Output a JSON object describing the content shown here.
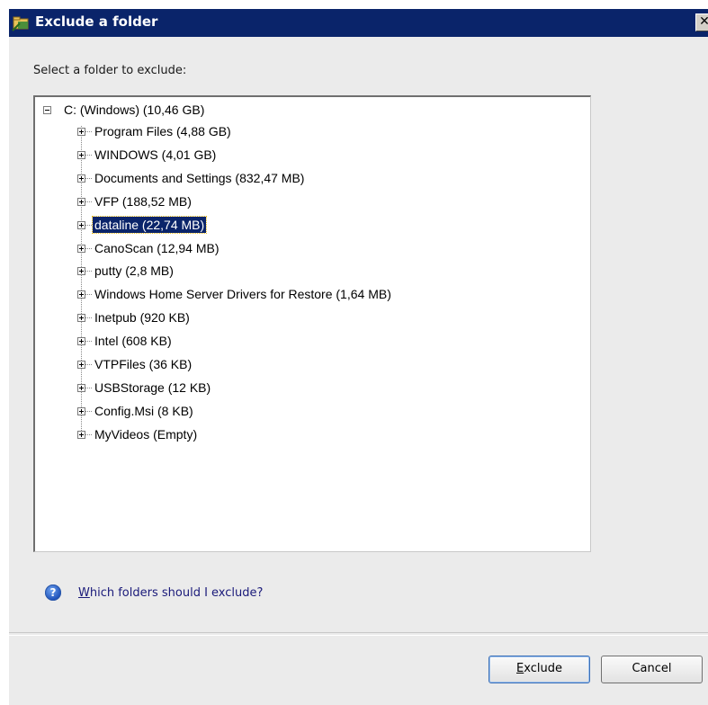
{
  "window": {
    "title": "Exclude a folder",
    "close_glyph": "✕",
    "icon": "folder-exclude-icon"
  },
  "dialog": {
    "prompt": "Select a folder to exclude:",
    "tree": {
      "root": {
        "label": "C: (Windows) (10,46 GB)",
        "expanded": true
      },
      "children": [
        {
          "label": "Program Files (4,88 GB)",
          "selected": false
        },
        {
          "label": "WINDOWS (4,01 GB)",
          "selected": false
        },
        {
          "label": "Documents and Settings (832,47 MB)",
          "selected": false
        },
        {
          "label": "VFP (188,52 MB)",
          "selected": false
        },
        {
          "label": "dataline (22,74 MB)",
          "selected": true
        },
        {
          "label": "CanoScan (12,94 MB)",
          "selected": false
        },
        {
          "label": "putty (2,8 MB)",
          "selected": false
        },
        {
          "label": "Windows Home Server Drivers for Restore (1,64 MB)",
          "selected": false
        },
        {
          "label": "Inetpub (920 KB)",
          "selected": false
        },
        {
          "label": "Intel (608 KB)",
          "selected": false
        },
        {
          "label": "VTPFiles (36 KB)",
          "selected": false
        },
        {
          "label": "USBStorage (12 KB)",
          "selected": false
        },
        {
          "label": "Config.Msi (8 KB)",
          "selected": false
        },
        {
          "label": "MyVideos (Empty)",
          "selected": false
        }
      ]
    },
    "help": {
      "icon": "help-icon",
      "icon_glyph": "?",
      "link_first_letter": "W",
      "link_rest": "hich folders should I exclude?"
    },
    "buttons": {
      "exclude_first_letter": "E",
      "exclude_rest": "xclude",
      "cancel": "Cancel"
    }
  },
  "colors": {
    "titlebar": "#0a246a",
    "selection": "#0a246a",
    "dialog_bg": "#ebebeb",
    "link": "#1a1a7a"
  }
}
